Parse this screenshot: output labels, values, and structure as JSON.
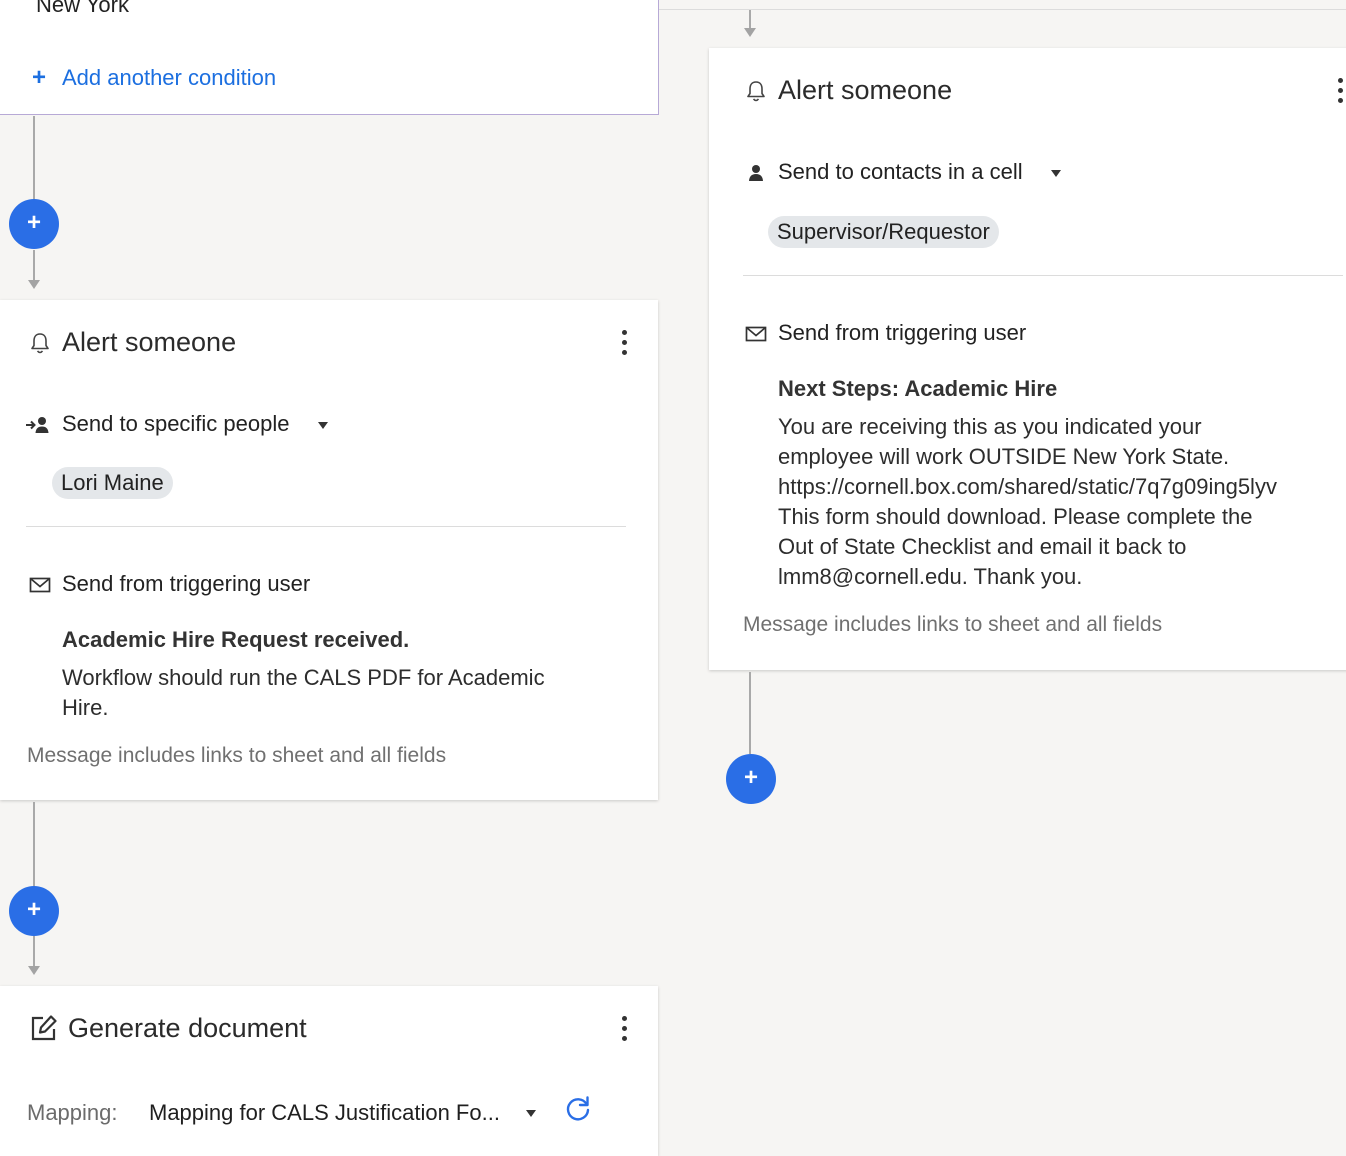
{
  "condition_card": {
    "partial_value": "New York",
    "add_condition_label": "Add another condition"
  },
  "left_alert": {
    "title": "Alert someone",
    "recipient_mode": "Send to specific people",
    "recipients": [
      "Lori Maine"
    ],
    "sender": "Send from triggering user",
    "subject": "Academic Hire Request received.",
    "body": "Workflow should run the CALS PDF for Academic\nHire.",
    "note": "Message includes links to sheet and all fields"
  },
  "right_alert": {
    "title": "Alert someone",
    "recipient_mode": "Send to contacts in a cell",
    "recipients": [
      "Supervisor/Requestor"
    ],
    "sender": "Send from triggering user",
    "subject": "Next Steps: Academic Hire",
    "body": "You are receiving this as you indicated your\nemployee will work OUTSIDE New York State.\nhttps://cornell.box.com/shared/static/7q7g09ing5lyv\nThis form should download. Please complete the\nOut of State Checklist and email it back to\nlmm8@cornell.edu. Thank you.",
    "note": "Message includes links to sheet and all fields"
  },
  "generate_doc": {
    "title": "Generate document",
    "mapping_label": "Mapping:",
    "mapping_value": "Mapping for CALS Justification Fo..."
  },
  "add_step_symbol": "+",
  "colors": {
    "accent": "#2a6ee6",
    "link": "#1c6fe0",
    "canvas": "#f6f5f3",
    "chip": "#e4e7ea"
  },
  "icons": [
    "plus-icon",
    "bell-icon",
    "person-arrow-icon",
    "person-icon",
    "mail-icon",
    "edit-document-icon",
    "refresh-icon",
    "kebab-menu-icon",
    "caret-down-icon"
  ]
}
